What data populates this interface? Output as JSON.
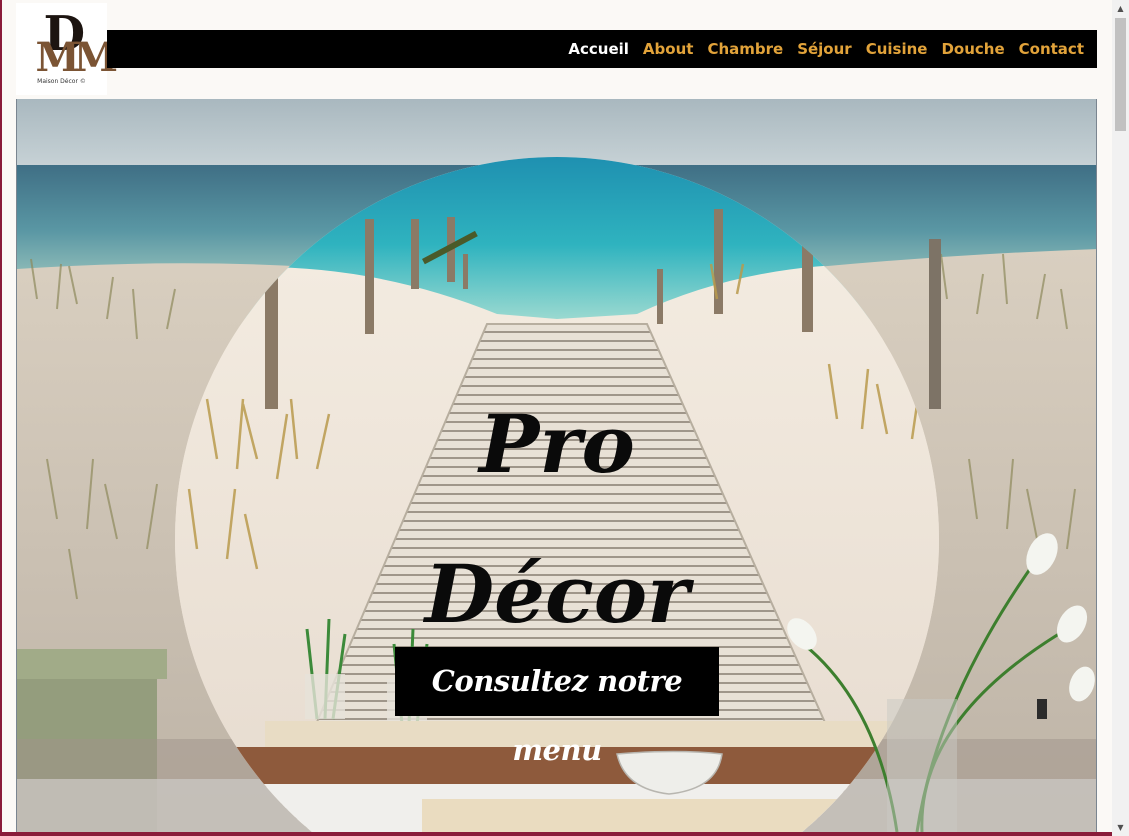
{
  "logo": {
    "mark_letters": [
      "D",
      "MM"
    ],
    "caption": "Maison Décor ©"
  },
  "nav": {
    "items": [
      {
        "label": "Accueil",
        "active": true
      },
      {
        "label": "About",
        "active": false
      },
      {
        "label": "Chambre",
        "active": false
      },
      {
        "label": "Séjour",
        "active": false
      },
      {
        "label": "Cuisine",
        "active": false
      },
      {
        "label": "Douche",
        "active": false
      },
      {
        "label": "Contact",
        "active": false
      }
    ],
    "active_color": "#ffffff",
    "link_color": "#e2a33a",
    "bar_color": "#000000"
  },
  "hero": {
    "title_line1": "Pro",
    "title_line2": "Décor",
    "cta_label": "Consultez notre menu",
    "image_icon": "beach-boardwalk-image"
  },
  "scrollbar": {
    "up_icon": "arrow-up-icon",
    "down_icon": "arrow-down-icon"
  }
}
